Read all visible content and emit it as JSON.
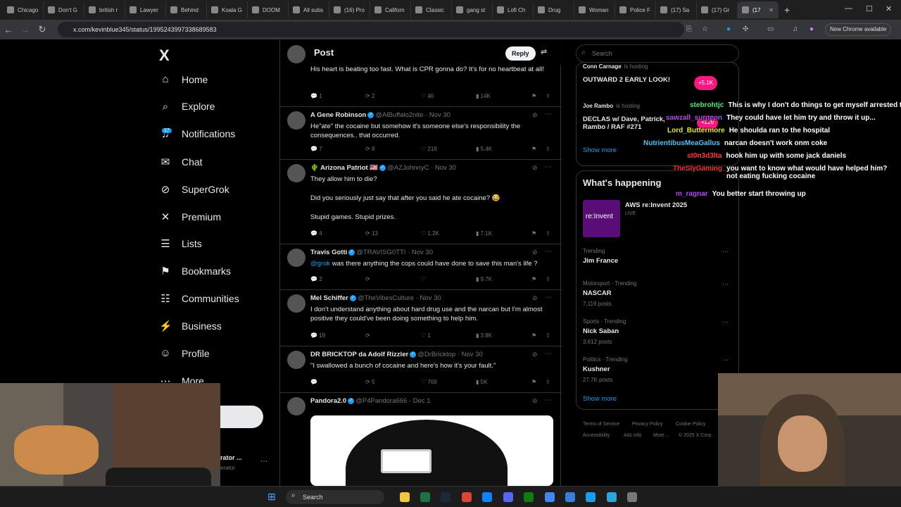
{
  "browser": {
    "tabs": [
      {
        "label": "Chicago",
        "active": false
      },
      {
        "label": "Don't G",
        "active": false
      },
      {
        "label": "british r",
        "active": false
      },
      {
        "label": "Lawyer",
        "active": false
      },
      {
        "label": "Behind",
        "active": false
      },
      {
        "label": "Koala G",
        "active": false
      },
      {
        "label": "DOOM",
        "active": false
      },
      {
        "label": "All subs",
        "active": false
      },
      {
        "label": "(16) Pro",
        "active": false
      },
      {
        "label": "Californ",
        "active": false
      },
      {
        "label": "Classic",
        "active": false
      },
      {
        "label": "gang st",
        "active": false
      },
      {
        "label": "Lofi Ch",
        "active": false
      },
      {
        "label": "Drug",
        "active": false
      },
      {
        "label": "Woman",
        "active": false
      },
      {
        "label": "Police F",
        "active": false
      },
      {
        "label": "(17) Sa",
        "active": false
      },
      {
        "label": "(17) Gr",
        "active": false
      },
      {
        "label": "(17",
        "active": true
      }
    ],
    "new_tab_label": "+",
    "url": "x.com/kevinblue345/status/1995243997338689583",
    "new_chrome_label": "New Chrome available"
  },
  "sidebar": {
    "logo": "X",
    "notifications_badge": "17",
    "items": [
      {
        "label": "Home",
        "icon": "home-icon",
        "glyph": "⌂"
      },
      {
        "label": "Explore",
        "icon": "search-icon",
        "glyph": "⌕"
      },
      {
        "label": "Notifications",
        "icon": "bell-icon",
        "glyph": "♫"
      },
      {
        "label": "Chat",
        "icon": "mail-icon",
        "glyph": "✉"
      },
      {
        "label": "SuperGrok",
        "icon": "grok-icon",
        "glyph": "⊘"
      },
      {
        "label": "Premium",
        "icon": "x-premium-icon",
        "glyph": "✕"
      },
      {
        "label": "Lists",
        "icon": "list-icon",
        "glyph": "☰"
      },
      {
        "label": "Bookmarks",
        "icon": "bookmark-icon",
        "glyph": "⚑"
      },
      {
        "label": "Communities",
        "icon": "communities-icon",
        "glyph": "☷"
      },
      {
        "label": "Business",
        "icon": "lightning-icon",
        "glyph": "⚡"
      },
      {
        "label": "Profile",
        "icon": "profile-icon",
        "glyph": "☺"
      },
      {
        "label": "More",
        "icon": "more-icon",
        "glyph": "⋯"
      }
    ],
    "account_name": "rator ...",
    "account_handle": "erator"
  },
  "feed": {
    "title": "Post",
    "reply_label": "Reply",
    "tweets": [
      {
        "name": "",
        "verified": false,
        "handle": "",
        "date": "",
        "text": "His heart is beating too fast. What is CPR gonna do? It's for no heartbeat at all!",
        "replies": "1",
        "reposts": "2",
        "likes": "40",
        "views": "14K"
      },
      {
        "name": "A Gene Robinson",
        "verified": true,
        "handle": "@AlBuffalo2nite",
        "date": "Nov 30",
        "text": "He\"ate\" the cocaine but somehow it's someone else's responsibility the consequences.. that occurred.",
        "replies": "7",
        "reposts": "8",
        "likes": "216",
        "views": "5.4K"
      },
      {
        "name": "🌵 Arizona Patriot 🇺🇸",
        "verified": true,
        "handle": "@AZJohnnyC",
        "date": "Nov 30",
        "text": "They allow him to die?",
        "text2": "Did you seriously just say that after you said he ate cocaine? 😂",
        "text3": "Stupid games. Stupid prizes.",
        "replies": "4",
        "reposts": "13",
        "likes": "1.2K",
        "views": "7.1K"
      },
      {
        "name": "Travis Gotti",
        "verified": true,
        "handle": "@TRAVISG0TTI",
        "date": "Nov 30",
        "mention": "@grok",
        "text": " was there anything the cops could have done to save this man's life ?",
        "replies": "2",
        "reposts": "",
        "likes": "",
        "views": "9.7K"
      },
      {
        "name": "Mel Schiffer",
        "verified": true,
        "handle": "@TheVibesCulture",
        "date": "Nov 30",
        "text": "I don't understand anything about hard drug use and the narcan but I'm almost positive they could've been doing something to help him.",
        "replies": "19",
        "reposts": "",
        "likes": "1",
        "views": "3.8K"
      },
      {
        "name": "DR BRICKTOP da Adolf Rizzler",
        "verified": true,
        "handle": "@DrBricktop",
        "date": "Nov 30",
        "text": "\"I swallowed a bunch of cocaine and here's how it's your fault.\"",
        "replies": "",
        "reposts": "5",
        "likes": "769",
        "views": "5K"
      },
      {
        "name": "Pandora2.0",
        "verified": true,
        "handle": "@P4Pandora666",
        "date": "Dec 1",
        "text": "",
        "replies": "",
        "reposts": "",
        "likes": "",
        "views": ""
      }
    ]
  },
  "right": {
    "search_placeholder": "Search",
    "spaces": [
      {
        "host": "Conn Carnage",
        "status": "is hosting",
        "title": "OUTWARD 2 EARLY LOOK!",
        "count": "+5.1K"
      },
      {
        "host": "Joe Rambo",
        "status": "is hosting",
        "title": "DECLAS w/ Dave, Patrick, Rambo / RAF #271",
        "count": "+226"
      }
    ],
    "show_more": "Show more",
    "happening_title": "What's happening",
    "event": {
      "thumb": "re:Invent",
      "title": "AWS re:Invent 2025",
      "live": "LIVE"
    },
    "trends": [
      {
        "context": "Trending",
        "name": "Jim France",
        "count": ""
      },
      {
        "context": "Motorsport · Trending",
        "name": "NASCAR",
        "count": "7,119 posts"
      },
      {
        "context": "Sports · Trending",
        "name": "Nick Saban",
        "count": "3,612 posts"
      },
      {
        "context": "Politics · Trending",
        "name": "Kushner",
        "count": "27.7K posts"
      }
    ],
    "footer": [
      "Terms of Service",
      "Privacy Policy",
      "Cookie Policy",
      "Accessibility",
      "Ads info",
      "More ...",
      "© 2025 X Corp."
    ]
  },
  "chat": [
    {
      "user": "stebrohtjc",
      "color": "#5fe37a",
      "msg": "This is why I don't do things to get myself arrested then eat coke"
    },
    {
      "user": "sawzall_surgeon",
      "color": "#b04be8",
      "msg": "They could have let him try and throw it up..."
    },
    {
      "user": "Lord_Buttermore",
      "color": "#e6e62a",
      "msg": "He shoulda ran to the hospital"
    },
    {
      "user": "NutrientibusMeaGallus",
      "color": "#4fc3f7",
      "msg": "narcan doesn't work onm coke"
    },
    {
      "user": "st0n3d3lta",
      "color": "#ff3b3b",
      "msg": "hook him up with some jack daniels"
    },
    {
      "user": "TheSlyGaming",
      "color": "#ff2a2a",
      "msg": "you want to know what would have helped him? not eating fucking cocaine"
    },
    {
      "user": "m_ragnar",
      "color": "#b04be8",
      "msg": "You better start throwing up"
    }
  ],
  "taskbar": {
    "search_label": "Search"
  },
  "colors": {
    "accent": "#1d9bf0",
    "background": "#000000",
    "border": "#2f3336",
    "muted": "#71767b"
  }
}
